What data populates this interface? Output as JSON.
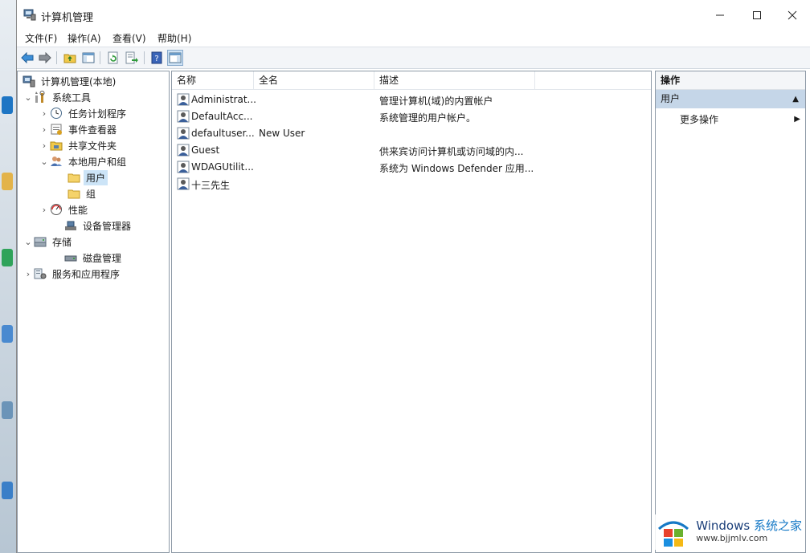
{
  "window": {
    "title": "计算机管理"
  },
  "menubar": [
    "文件(F)",
    "操作(A)",
    "查看(V)",
    "帮助(H)"
  ],
  "tree": [
    {
      "label": "计算机管理(本地)",
      "indent": 0,
      "twisty": "",
      "icon": "computer-management-icon"
    },
    {
      "label": "系统工具",
      "indent": 1,
      "twisty": "expanded",
      "icon": "system-tools-icon"
    },
    {
      "label": "任务计划程序",
      "indent": 2,
      "twisty": "collapsed",
      "icon": "clock-icon"
    },
    {
      "label": "事件查看器",
      "indent": 2,
      "twisty": "collapsed",
      "icon": "event-viewer-icon"
    },
    {
      "label": "共享文件夹",
      "indent": 2,
      "twisty": "collapsed",
      "icon": "shared-folder-icon"
    },
    {
      "label": "本地用户和组",
      "indent": 2,
      "twisty": "expanded",
      "icon": "users-groups-icon"
    },
    {
      "label": "用户",
      "indent": 3,
      "twisty": "",
      "icon": "folder-icon",
      "selected": true
    },
    {
      "label": "组",
      "indent": 3,
      "twisty": "",
      "icon": "folder-icon"
    },
    {
      "label": "性能",
      "indent": 2,
      "twisty": "collapsed",
      "icon": "performance-icon"
    },
    {
      "label": "设备管理器",
      "indent": 2,
      "twisty": "",
      "icon": "device-manager-icon"
    },
    {
      "label": "存储",
      "indent": 1,
      "twisty": "expanded",
      "icon": "storage-icon"
    },
    {
      "label": "磁盘管理",
      "indent": 2,
      "twisty": "",
      "icon": "disk-management-icon"
    },
    {
      "label": "服务和应用程序",
      "indent": 1,
      "twisty": "collapsed",
      "icon": "services-icon"
    }
  ],
  "list": {
    "columns": [
      "名称",
      "全名",
      "描述"
    ],
    "rows": [
      {
        "name": "Administrat...",
        "fullname": "",
        "description": "管理计算机(域)的内置帐户",
        "icon": "user-icon"
      },
      {
        "name": "DefaultAcc...",
        "fullname": "",
        "description": "系统管理的用户帐户。",
        "icon": "user-icon"
      },
      {
        "name": "defaultuser...",
        "fullname": "New User",
        "description": "",
        "icon": "user-icon"
      },
      {
        "name": "Guest",
        "fullname": "",
        "description": "供来宾访问计算机或访问域的内...",
        "icon": "user-icon"
      },
      {
        "name": "WDAGUtilit...",
        "fullname": "",
        "description": "系统为 Windows Defender 应用...",
        "icon": "user-icon"
      },
      {
        "name": "十三先生",
        "fullname": "",
        "description": "",
        "icon": "user-icon"
      }
    ]
  },
  "actions": {
    "header": "操作",
    "group": "用户",
    "items": [
      "更多操作"
    ]
  },
  "watermark": {
    "brand": "Windows",
    "cn": "系统之家",
    "url": "www.bjjmlv.com"
  }
}
